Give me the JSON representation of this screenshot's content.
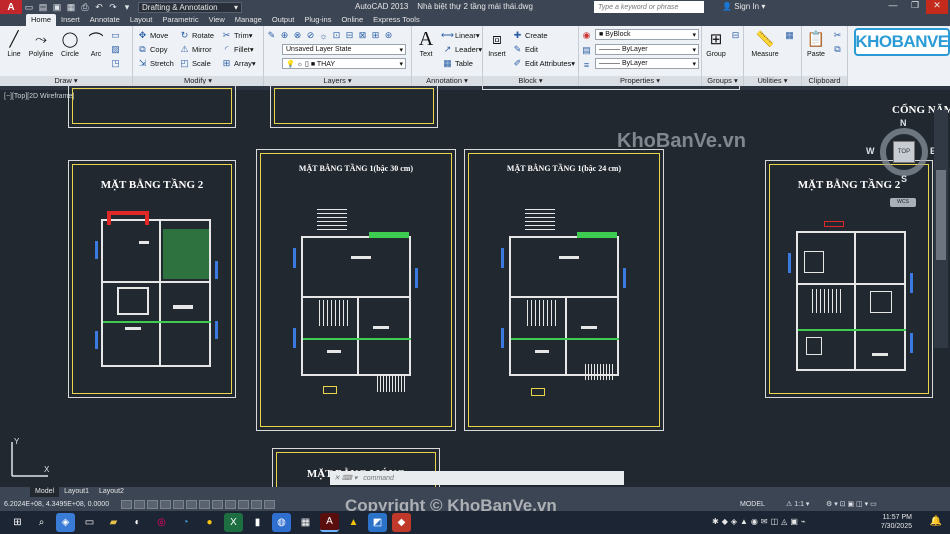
{
  "titlebar": {
    "workspace": "Drafting & Annotation",
    "app_title": "AutoCAD 2013",
    "file_title": "Nhà biệt thự 2 tầng mái thái.dwg",
    "search_placeholder": "Type a keyword or phrase",
    "sign_in": "Sign In"
  },
  "ribbon_tabs": [
    "Home",
    "Insert",
    "Annotate",
    "Layout",
    "Parametric",
    "View",
    "Manage",
    "Output",
    "Plug-ins",
    "Online",
    "Express Tools"
  ],
  "draw": {
    "title": "Draw",
    "line": "Line",
    "polyline": "Polyline",
    "circle": "Circle",
    "arc": "Arc"
  },
  "modify": {
    "title": "Modify",
    "move": "Move",
    "rotate": "Rotate",
    "trim": "Trim",
    "copy": "Copy",
    "mirror": "Mirror",
    "fillet": "Fillet",
    "stretch": "Stretch",
    "scale": "Scale",
    "array": "Array"
  },
  "layers": {
    "title": "Layers",
    "state": "Unsaved Layer State",
    "current": "THAY"
  },
  "annotation": {
    "title": "Annotation",
    "text": "Text",
    "linear": "Linear",
    "leader": "Leader",
    "table": "Table"
  },
  "block": {
    "title": "Block",
    "insert": "Insert",
    "create": "Create",
    "edit": "Edit",
    "edit_attributes": "Edit Attributes"
  },
  "properties": {
    "title": "Properties",
    "color": "ByBlock",
    "linetype": "ByLayer",
    "lineweight": "ByLayer"
  },
  "groups": {
    "title": "Groups",
    "group": "Group"
  },
  "utilities": {
    "title": "Utilities",
    "measure": "Measure"
  },
  "clipboard": {
    "title": "Clipboard",
    "paste": "Paste"
  },
  "brand_logo": "KHOBANVE",
  "viewport_label": "[−][Top][2D Wireframe]",
  "sheets": {
    "s1": "MẶT BẰNG TẦNG 2",
    "s2": "MẶT BẰNG TẦNG 1(bậc 30 cm)",
    "s3": "MẶT BẰNG TẦNG 1(bậc 24 cm)",
    "s4": "MẶT BẰNG TẦNG 2",
    "s5": "MẶT BẰNG MÓNG",
    "s6": "CỔNG NĂM"
  },
  "watermark": "KhoBanVe.vn",
  "viewcube": {
    "top": "TOP",
    "n": "N",
    "s": "S",
    "e": "E",
    "w": "W",
    "wcs": "WCS"
  },
  "command_placeholder": "command",
  "layout_tabs": [
    "Model",
    "Layout1",
    "Layout2"
  ],
  "status": {
    "coords": "6.2024E+08, 4.3495E+08, 0.0000",
    "model": "MODEL",
    "scale": "1:1"
  },
  "copyright": "Copyright © KhoBanVe.vn",
  "clock": {
    "time": "11:57 PM",
    "date": "7/30/2025"
  }
}
